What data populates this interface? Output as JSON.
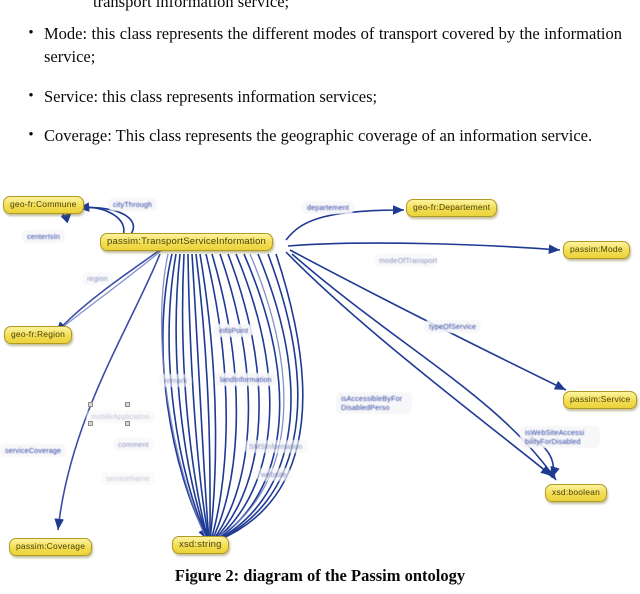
{
  "document": {
    "clipped_top_line": "transport information service;",
    "bullets": [
      {
        "marker": "•",
        "text": "Mode: this class represents the different modes of transport covered by the information service;"
      },
      {
        "marker": "•",
        "text": "Service: this class represents information services;"
      },
      {
        "marker": "•",
        "text": "Coverage: This class represents the geographic coverage of an information service."
      }
    ],
    "caption": "Figure 2: diagram of the Passim ontology"
  },
  "diagram": {
    "colors": {
      "node_fill": "#f2dd52",
      "node_border": "#b09a22",
      "node_text": "#4a4410",
      "edge": "#1f3a93",
      "label_text": "#2b3ea0",
      "background": "#ffffff"
    },
    "nodes": [
      {
        "id": "commune",
        "label": "geo-fr:Commune"
      },
      {
        "id": "central",
        "label": "passim:TransportServiceInformation"
      },
      {
        "id": "departement",
        "label": "geo-fr:Departement"
      },
      {
        "id": "mode",
        "label": "passim:Mode"
      },
      {
        "id": "region",
        "label": "geo-fr:Region"
      },
      {
        "id": "service",
        "label": "passim:Service"
      },
      {
        "id": "boolean",
        "label": "xsd:boolean"
      },
      {
        "id": "coverage",
        "label": "passim:Coverage"
      },
      {
        "id": "string",
        "label": "xsd:string"
      }
    ],
    "edge_labels": [
      {
        "id": "cityThrough",
        "label": "cityThrough"
      },
      {
        "id": "centerIsIn",
        "label": "centerIsIn"
      },
      {
        "id": "region",
        "label": "region"
      },
      {
        "id": "departement",
        "label": "departement"
      },
      {
        "id": "modeOfTransport",
        "label": "modeOfTransport"
      },
      {
        "id": "typeOfService",
        "label": "typeOfService"
      },
      {
        "id": "infoPoint",
        "label": "infoPoint"
      },
      {
        "id": "landInformation",
        "label": "landInformation"
      },
      {
        "id": "remark",
        "label": "remark"
      },
      {
        "id": "mobileApplication",
        "label": "mobileApplication"
      },
      {
        "id": "comment",
        "label": "comment"
      },
      {
        "id": "serviceName",
        "label": "serviceName"
      },
      {
        "id": "serviceCoverage",
        "label": "serviceCoverage"
      },
      {
        "id": "SMSInformation",
        "label": "SMSInformation"
      },
      {
        "id": "website",
        "label": "website"
      },
      {
        "id": "isAccessible",
        "label": "isAccessibleByFor DisabledPerso"
      },
      {
        "id": "isWebSiteAccessible",
        "label": "isWebSiteAccessi bilityForDisabled"
      }
    ]
  }
}
